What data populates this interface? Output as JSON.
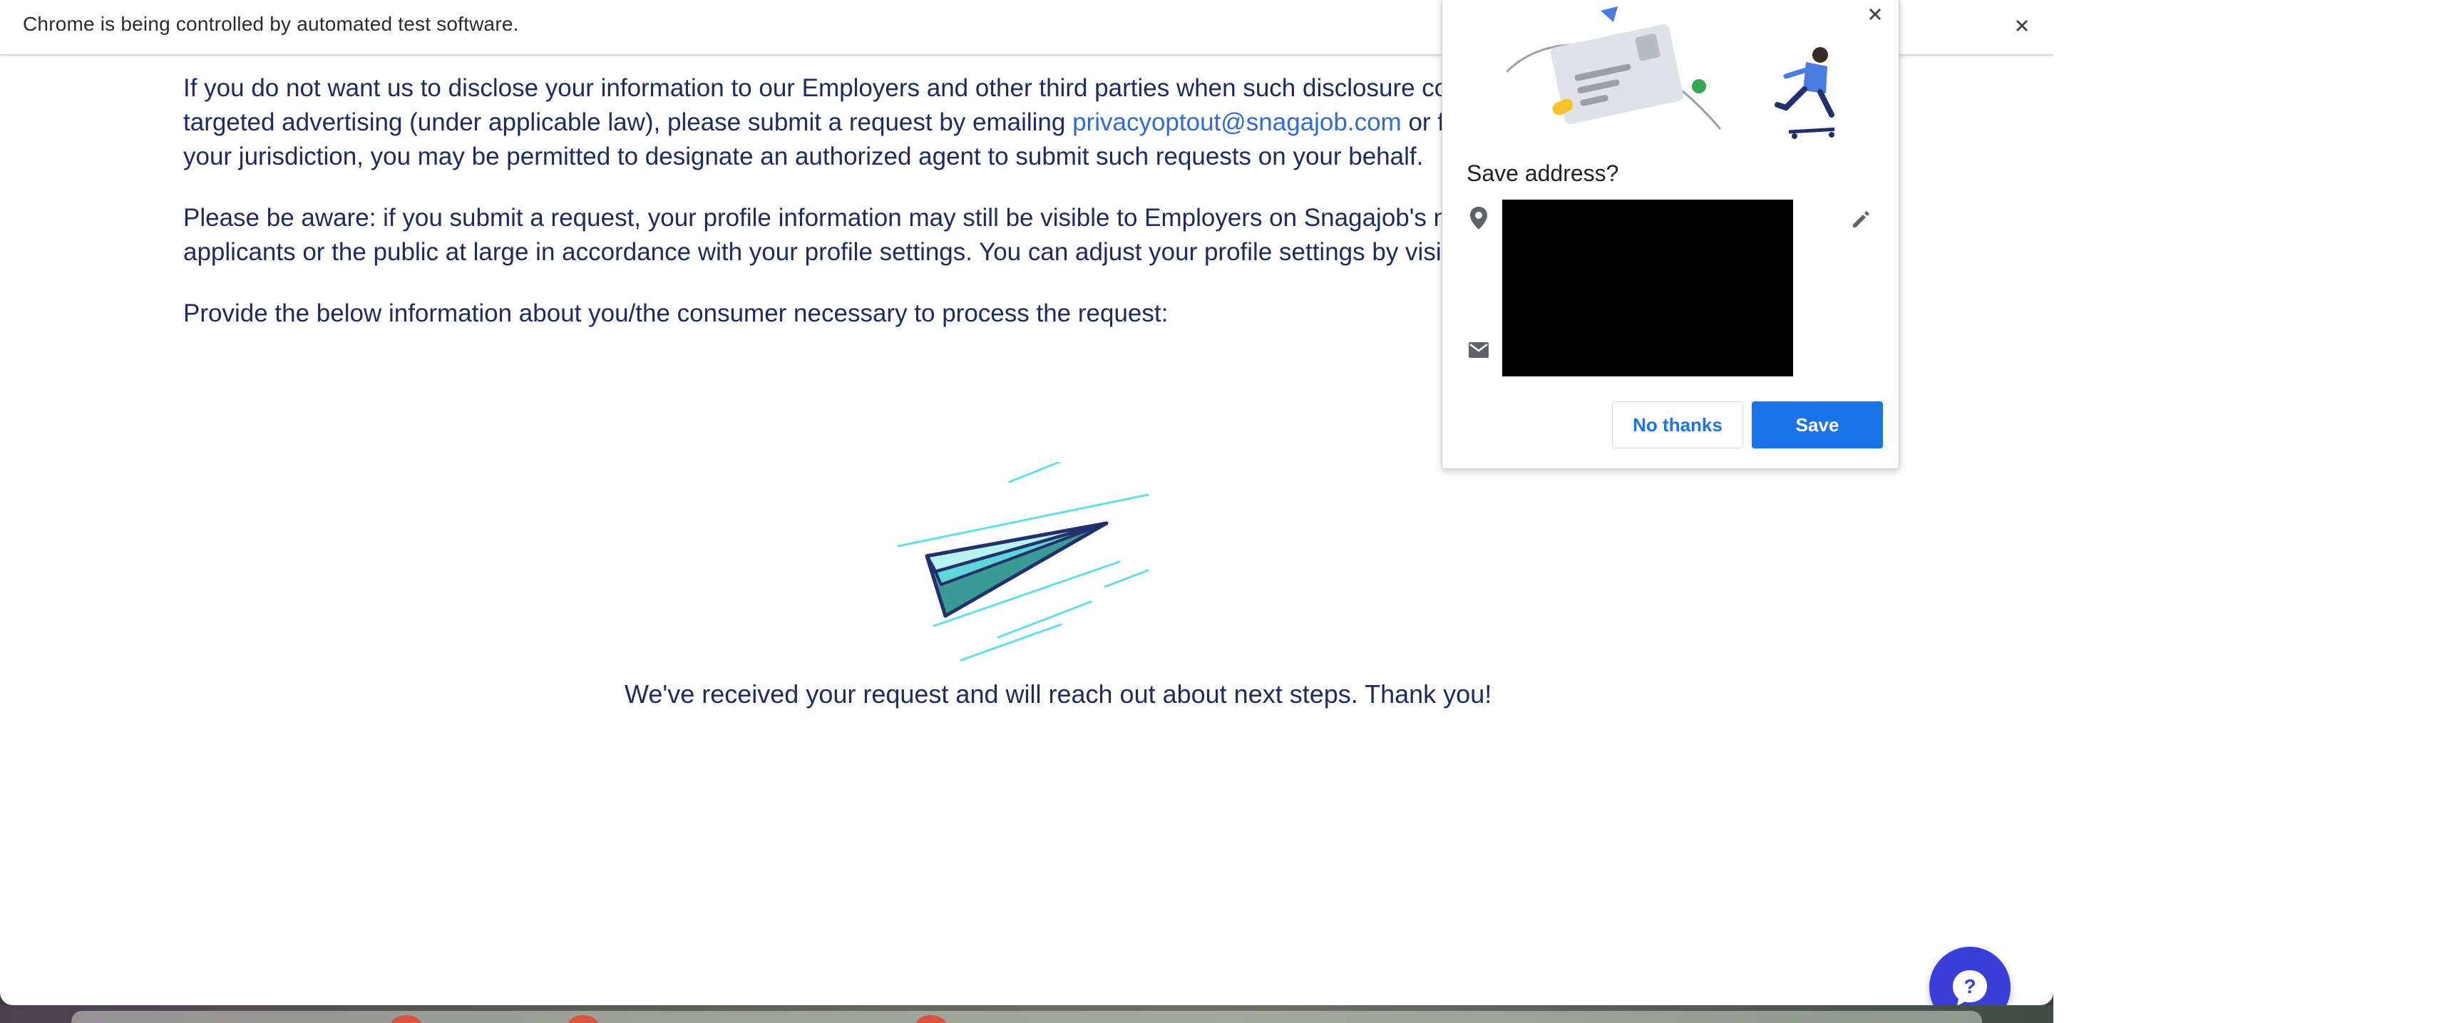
{
  "infobar": {
    "message": "Chrome is being controlled by automated test software."
  },
  "page": {
    "paragraphs": {
      "p1_line1": "If you do not want us to disclose your information to our Employers and other third parties when such disclosure constitute",
      "p1_line2_before": "targeted advertising (under applicable law), please submit a request by emailing ",
      "p1_email": "privacyoptout@snagajob.com",
      "p1_line2_after": " or filling out",
      "p1_line3": "your jurisdiction, you may be permitted to designate an authorized agent to submit such requests on your behalf.",
      "p2_line1": "Please be aware: if you submit a request, your profile information may still be visible to Employers on Snagajob's network wh",
      "p2_line2": "applicants or the public at large in accordance with your profile settings. You can adjust your profile settings by visiting this",
      "p3": "Provide the below information about you/the consumer necessary to process the request:"
    },
    "success_message": "We've received your request and will reach out about next steps. Thank you!"
  },
  "save_address_popup": {
    "title": "Save address?",
    "no_thanks_label": "No thanks",
    "save_label": "Save"
  },
  "icons": {
    "infobar_close": "close-icon",
    "popup_close": "close-icon",
    "location": "location-pin-icon",
    "email": "mail-icon",
    "edit": "pencil-icon",
    "help": "chat-help-icon",
    "illustration": "paper-plane-illustration"
  },
  "colors": {
    "body_text": "#1d2a64",
    "link": "#2e6bd8",
    "primary_button": "#1a73e8",
    "help_button": "#3a3fd9",
    "plane_fill": "#3a9a94",
    "plane_lines": "#5fe0e8"
  }
}
